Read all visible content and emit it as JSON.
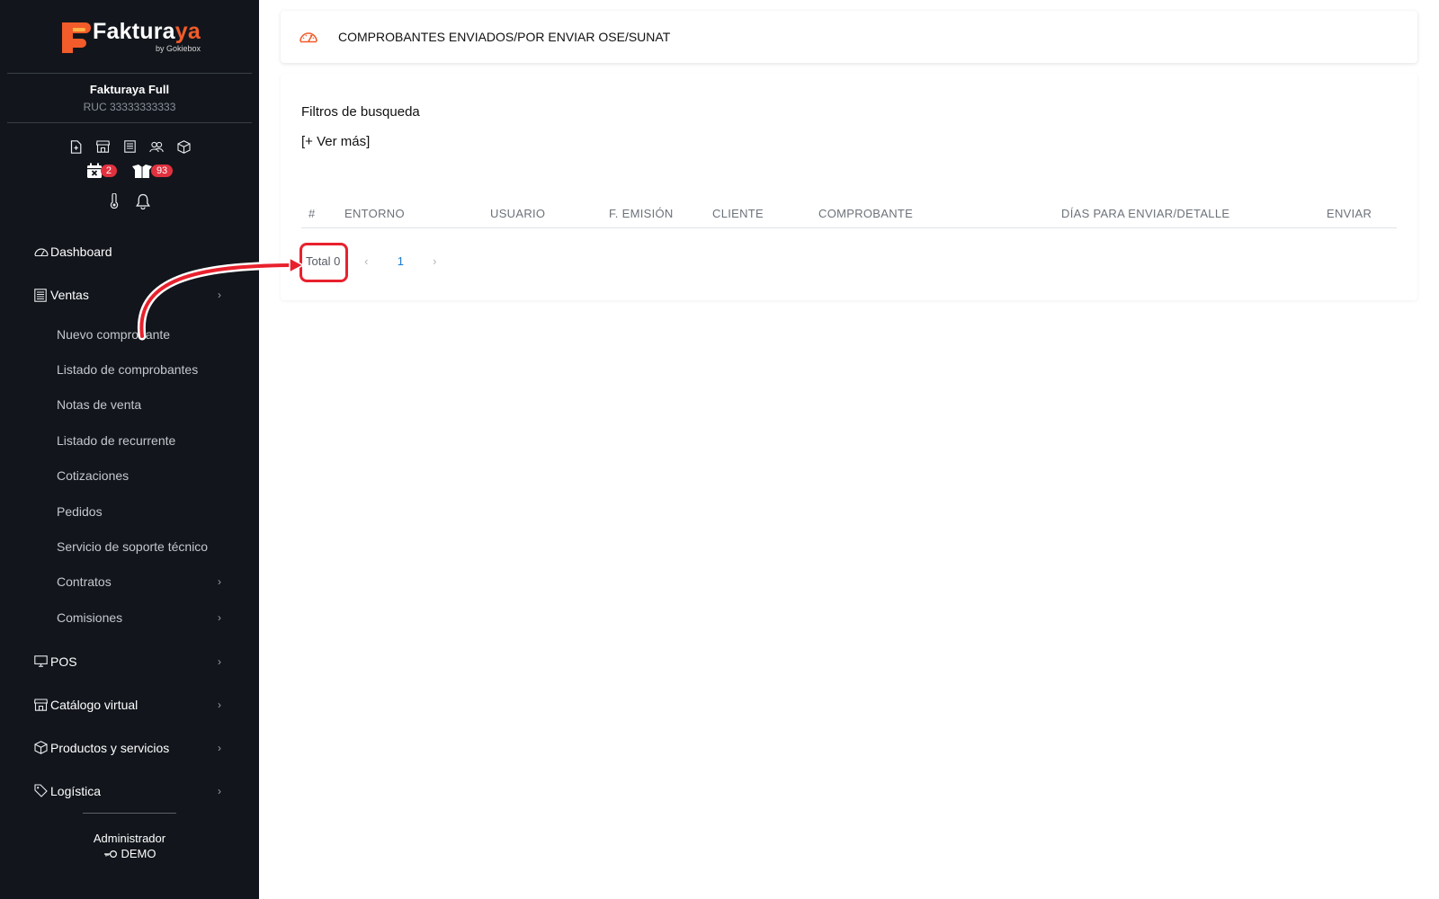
{
  "brand": {
    "name_main": "Faktura",
    "name_accent": "ya",
    "byline": "by Gokiebox",
    "accent_color": "#f25c2a"
  },
  "company": {
    "name": "Fakturaya Full",
    "ruc": "RUC 33333333333"
  },
  "quick_icons": [
    "new-document-icon",
    "store-icon",
    "receipt-list-icon",
    "users-icon",
    "box-icon"
  ],
  "badges": {
    "calendar_count": "2",
    "boxes_count": "93",
    "badge_color": "#e0313f"
  },
  "menu": {
    "dashboard": "Dashboard",
    "ventas": "Ventas",
    "ventas_sub": [
      "Nuevo comprobante",
      "Listado de comprobantes",
      "Notas de venta",
      "Listado de recurrente",
      "Cotizaciones",
      "Pedidos",
      "Servicio de soporte técnico",
      "Contratos",
      "Comisiones"
    ],
    "pos": "POS",
    "catalogo": "Catálogo virtual",
    "productos": "Productos y servicios",
    "logistica": "Logística"
  },
  "footer": {
    "user": "Administrador",
    "role": "DEMO"
  },
  "header": {
    "title": "COMPROBANTES ENVIADOS/POR ENVIAR OSE/SUNAT"
  },
  "filters": {
    "title": "Filtros de busqueda",
    "more": "[+ Ver más]"
  },
  "table": {
    "columns": [
      "#",
      "ENTORNO",
      "USUARIO",
      "F. EMISIÓN",
      "CLIENTE",
      "COMPROBANTE",
      "DÍAS PARA ENVIAR/DETALLE",
      "ENVIAR"
    ]
  },
  "pagination": {
    "total": "Total 0",
    "prev": "‹",
    "current_page": "1",
    "next": "›"
  },
  "annotation": {
    "highlight_color": "#e8212d"
  }
}
